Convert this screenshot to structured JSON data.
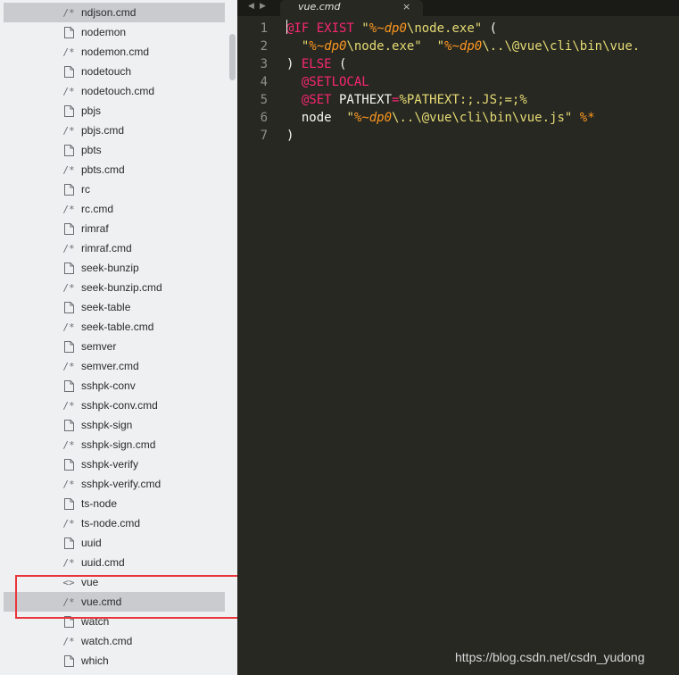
{
  "sidebar": {
    "files": [
      {
        "name": "ndjson.cmd",
        "icon": "comment-file-icon",
        "selected": true
      },
      {
        "name": "nodemon",
        "icon": "document-icon"
      },
      {
        "name": "nodemon.cmd",
        "icon": "comment-file-icon"
      },
      {
        "name": "nodetouch",
        "icon": "document-icon"
      },
      {
        "name": "nodetouch.cmd",
        "icon": "comment-file-icon"
      },
      {
        "name": "pbjs",
        "icon": "document-icon"
      },
      {
        "name": "pbjs.cmd",
        "icon": "comment-file-icon"
      },
      {
        "name": "pbts",
        "icon": "document-icon"
      },
      {
        "name": "pbts.cmd",
        "icon": "comment-file-icon"
      },
      {
        "name": "rc",
        "icon": "document-icon"
      },
      {
        "name": "rc.cmd",
        "icon": "comment-file-icon"
      },
      {
        "name": "rimraf",
        "icon": "document-icon"
      },
      {
        "name": "rimraf.cmd",
        "icon": "comment-file-icon"
      },
      {
        "name": "seek-bunzip",
        "icon": "document-icon"
      },
      {
        "name": "seek-bunzip.cmd",
        "icon": "comment-file-icon"
      },
      {
        "name": "seek-table",
        "icon": "document-icon"
      },
      {
        "name": "seek-table.cmd",
        "icon": "comment-file-icon"
      },
      {
        "name": "semver",
        "icon": "document-icon"
      },
      {
        "name": "semver.cmd",
        "icon": "comment-file-icon"
      },
      {
        "name": "sshpk-conv",
        "icon": "document-icon"
      },
      {
        "name": "sshpk-conv.cmd",
        "icon": "comment-file-icon"
      },
      {
        "name": "sshpk-sign",
        "icon": "document-icon"
      },
      {
        "name": "sshpk-sign.cmd",
        "icon": "comment-file-icon"
      },
      {
        "name": "sshpk-verify",
        "icon": "document-icon"
      },
      {
        "name": "sshpk-verify.cmd",
        "icon": "comment-file-icon"
      },
      {
        "name": "ts-node",
        "icon": "document-icon"
      },
      {
        "name": "ts-node.cmd",
        "icon": "comment-file-icon"
      },
      {
        "name": "uuid",
        "icon": "document-icon"
      },
      {
        "name": "uuid.cmd",
        "icon": "comment-file-icon"
      },
      {
        "name": "vue",
        "icon": "code-file-icon"
      },
      {
        "name": "vue.cmd",
        "icon": "comment-file-icon",
        "selected": true
      },
      {
        "name": "watch",
        "icon": "document-icon"
      },
      {
        "name": "watch.cmd",
        "icon": "comment-file-icon"
      },
      {
        "name": "which",
        "icon": "document-icon"
      }
    ],
    "highlight_color": "#e8363c"
  },
  "tabs": {
    "back_arrow": "◀",
    "forward_arrow": "▶",
    "active_title": "vue.cmd",
    "close_glyph": "×"
  },
  "editor": {
    "lines": [
      {
        "num": "1",
        "tokens": [
          {
            "t": "@IF EXIST ",
            "c": "kw"
          },
          {
            "t": "\"",
            "c": "str"
          },
          {
            "t": "%~dp0",
            "c": "var"
          },
          {
            "t": "\\node.exe\"",
            "c": "str"
          },
          {
            "t": " (",
            "c": "plain"
          }
        ]
      },
      {
        "num": "2",
        "tokens": [
          {
            "t": "  ",
            "c": "plain"
          },
          {
            "t": "\"",
            "c": "str"
          },
          {
            "t": "%~dp0",
            "c": "var"
          },
          {
            "t": "\\node.exe\"",
            "c": "str"
          },
          {
            "t": "  ",
            "c": "plain"
          },
          {
            "t": "\"",
            "c": "str"
          },
          {
            "t": "%~dp0",
            "c": "var"
          },
          {
            "t": "\\..\\@vue\\cli\\bin\\vue.",
            "c": "str"
          }
        ]
      },
      {
        "num": "3",
        "tokens": [
          {
            "t": ") ",
            "c": "plain"
          },
          {
            "t": "ELSE",
            "c": "kw"
          },
          {
            "t": " (",
            "c": "plain"
          }
        ]
      },
      {
        "num": "4",
        "tokens": [
          {
            "t": "  ",
            "c": "plain"
          },
          {
            "t": "@SETLOCAL",
            "c": "kw"
          }
        ]
      },
      {
        "num": "5",
        "tokens": [
          {
            "t": "  ",
            "c": "plain"
          },
          {
            "t": "@SET",
            "c": "kw"
          },
          {
            "t": " PATHEXT",
            "c": "plain"
          },
          {
            "t": "=",
            "c": "kw"
          },
          {
            "t": "%PATHEXT:;.JS;=;%",
            "c": "str"
          }
        ]
      },
      {
        "num": "6",
        "tokens": [
          {
            "t": "  node  ",
            "c": "plain"
          },
          {
            "t": "\"",
            "c": "str"
          },
          {
            "t": "%~dp0",
            "c": "var"
          },
          {
            "t": "\\..\\@vue\\cli\\bin\\vue.js\"",
            "c": "str"
          },
          {
            "t": " ",
            "c": "plain"
          },
          {
            "t": "%*",
            "c": "var"
          }
        ]
      },
      {
        "num": "7",
        "tokens": [
          {
            "t": ")",
            "c": "plain"
          }
        ]
      }
    ],
    "colors": {
      "background": "#272822",
      "keyword": "#f92672",
      "string": "#e6db74",
      "variable": "#fd971f",
      "plain": "#f8f8f2",
      "gutter": "#8f908a"
    }
  },
  "watermark": "https://blog.csdn.net/csdn_yudong"
}
